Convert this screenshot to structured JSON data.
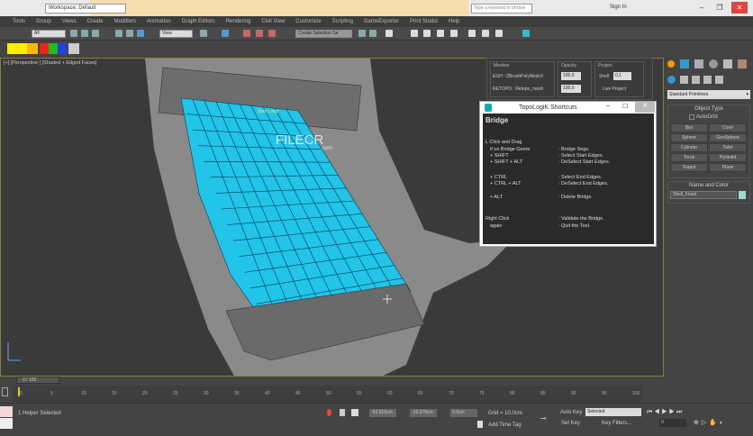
{
  "titlebar": {
    "workspace": "Workspace: Default",
    "search_placeholder": "Type a keyword or phrase",
    "sign_in": "Sign In",
    "minimize": "–",
    "restore": "❐",
    "close": "✕"
  },
  "menu": [
    "Tools",
    "Group",
    "Views",
    "Create",
    "Modifiers",
    "Animation",
    "Graph Editors",
    "Rendering",
    "Civil View",
    "Customize",
    "Scripting",
    "GameExporter",
    "Print Studio",
    "Help"
  ],
  "toolbar": {
    "filter": "All",
    "view": "View",
    "selection_set": "Create Selection Se"
  },
  "swatch_colors": [
    "#ffee00",
    "#ffbb00",
    "#ee2222",
    "#22bb22",
    "#2244dd",
    "#cccccc"
  ],
  "viewport": {
    "label": "[+] [Perspective ] [Shaded + Edged Faces]",
    "start_loop": "Start Loop",
    "watermark": "FILECR",
    "watermark_sub": ".com"
  },
  "panel": {
    "meshes_label": "Meshes",
    "opacity_label": "Opacity",
    "project_label": "Project",
    "mesh1": "EGH : ZBrushPolyMesh3",
    "mesh2": "RETOPO : Retopo_mesh",
    "opacity1": "100.0",
    "opacity2": "100.0",
    "shell_label": "Shell:",
    "shell_value": "0.1",
    "live_project": "Live Project"
  },
  "popup": {
    "title": "TopoLogiK Shortcuts",
    "heading": "Bridge",
    "rows": [
      {
        "key": "L Click and Drag",
        "desc": ""
      },
      {
        "key": "  if on Bridge Geom",
        "desc": ": Bridge Segs."
      },
      {
        "key": "  + SHIFT",
        "desc": ": Select Start Edges."
      },
      {
        "key": "  + SHIFT + ALT",
        "desc": ": DeSelect Start Edges."
      },
      {
        "key": "  + CTRL",
        "desc": ": Select End Edges."
      },
      {
        "key": "  + CTRL + ALT",
        "desc": ": DeSelect End Edges."
      },
      {
        "key": "  + ALT",
        "desc": ": Delete Bridge."
      },
      {
        "key": "Right Click",
        "desc": ": Validate the Bridge."
      },
      {
        "key": "  again",
        "desc": ": Quit the Tool."
      }
    ]
  },
  "command_panel": {
    "dropdown": "Standard Primitives",
    "object_type": "Object Type",
    "autogrid": "AutoGrid",
    "buttons": [
      "Box",
      "Cone",
      "Sphere",
      "GeoSphere",
      "Cylinder",
      "Tube",
      "Torus",
      "Pyramid",
      "Teapot",
      "Plane"
    ],
    "name_color": "Name and Color",
    "name_value": "Shell_Fixed"
  },
  "timeline": {
    "frame": "0 / 100",
    "ticks": [
      "0",
      "5",
      "10",
      "15",
      "20",
      "25",
      "30",
      "35",
      "40",
      "45",
      "50",
      "55",
      "60",
      "65",
      "70",
      "75",
      "80",
      "85",
      "90",
      "95",
      "100"
    ]
  },
  "status": {
    "selected": "1 Helper Selected",
    "x": "-52.016cm",
    "y": "-16.579cm",
    "z": "0.0cm",
    "grid": "Grid = 10.0cm",
    "add_time_tag": "Add Time Tag",
    "auto_key": "Auto Key",
    "selected_dropdown": "Selected",
    "set_key": "Set Key",
    "key_filters": "Key Filters...",
    "frame": "0"
  }
}
